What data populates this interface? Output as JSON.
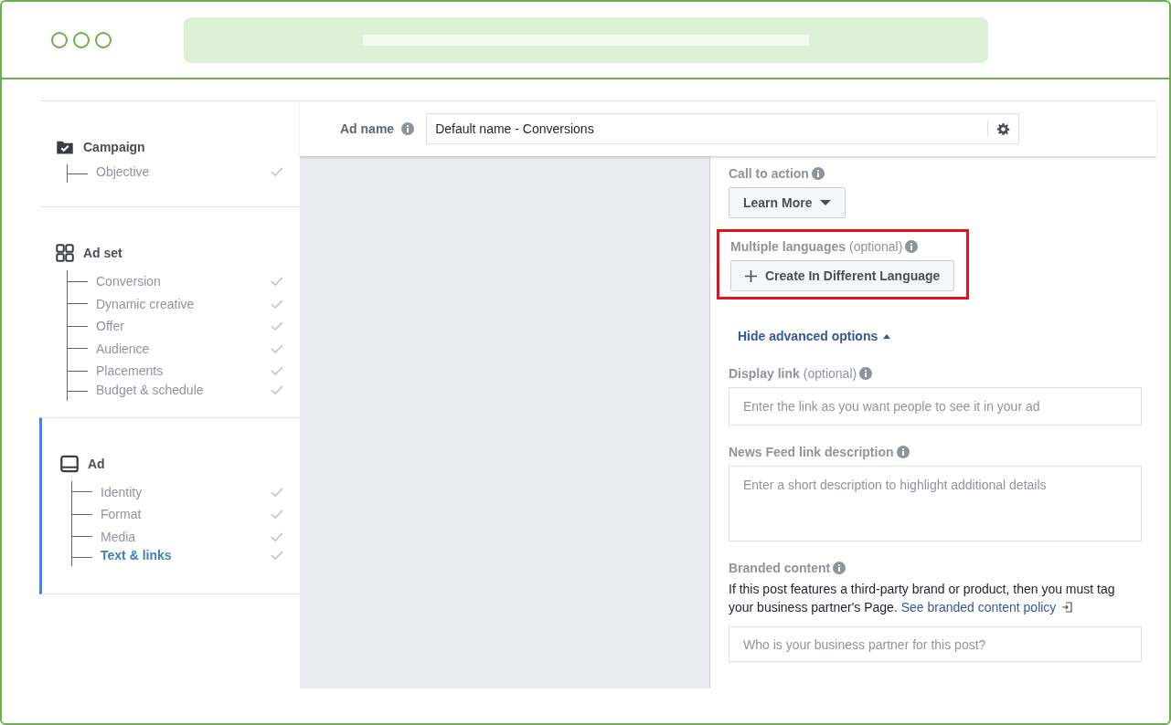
{
  "sidebar": {
    "sections": [
      {
        "title": "Campaign",
        "selected": false,
        "items": [
          {
            "label": "Objective",
            "selected": false,
            "done": true
          }
        ]
      },
      {
        "title": "Ad set",
        "selected": false,
        "items": [
          {
            "label": "Conversion",
            "selected": false,
            "done": true
          },
          {
            "label": "Dynamic creative",
            "selected": false,
            "done": true
          },
          {
            "label": "Offer",
            "selected": false,
            "done": true
          },
          {
            "label": "Audience",
            "selected": false,
            "done": true
          },
          {
            "label": "Placements",
            "selected": false,
            "done": true
          },
          {
            "label": "Budget & schedule",
            "selected": false,
            "done": true
          }
        ]
      },
      {
        "title": "Ad",
        "selected": true,
        "items": [
          {
            "label": "Identity",
            "selected": false,
            "done": true
          },
          {
            "label": "Format",
            "selected": false,
            "done": true
          },
          {
            "label": "Media",
            "selected": false,
            "done": true
          },
          {
            "label": "Text & links",
            "selected": true,
            "done": true
          }
        ]
      }
    ]
  },
  "ad_name": {
    "label": "Ad name",
    "value": "Default name - Conversions"
  },
  "call_to_action": {
    "label": "Call to action",
    "button": "Learn More"
  },
  "multiple_languages": {
    "label": "Multiple languages",
    "hint": "(optional)",
    "button": "Create In Different Language",
    "highlighted": true
  },
  "advanced_toggle": {
    "label": "Hide advanced options",
    "expanded": true
  },
  "display_link": {
    "label": "Display link",
    "hint": "(optional)",
    "placeholder": "Enter the link as you want people to see it in your ad"
  },
  "news_feed_description": {
    "label": "News Feed link description",
    "placeholder": "Enter a short description to highlight additional details"
  },
  "branded_content": {
    "label": "Branded content",
    "text": "If this post features a third-party brand or product, then you must tag your business partner's Page.",
    "link": "See branded content policy",
    "placeholder": "Who is your business partner for this post?"
  }
}
